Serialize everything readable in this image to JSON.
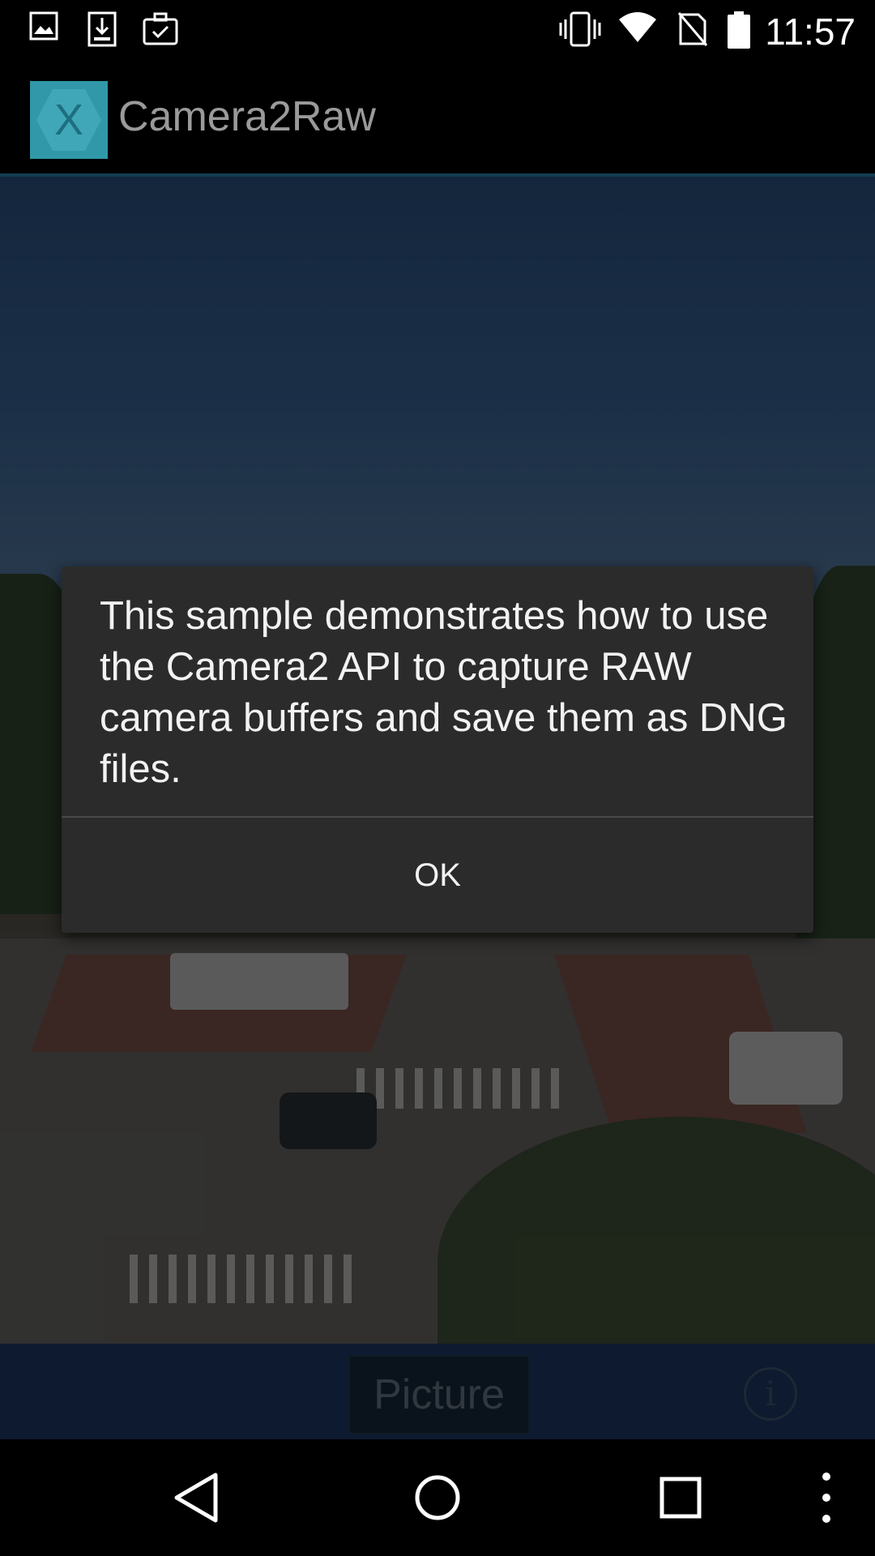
{
  "status_bar": {
    "time": "11:57",
    "left_icons": [
      "image-notification-icon",
      "download-notification-icon",
      "briefcase-notification-icon"
    ],
    "right_icons": [
      "vibrate-icon",
      "wifi-icon",
      "no-sim-icon",
      "battery-icon"
    ]
  },
  "action_bar": {
    "app_icon_letter": "X",
    "title": "Camera2Raw",
    "accent_color": "#3098a8"
  },
  "dialog": {
    "message": "This sample demonstrates how to use the Camera2 API to capture RAW camera buffers and save them as DNG files.",
    "ok_label": "OK"
  },
  "bottom_bar": {
    "picture_label": "Picture",
    "info_label": "i",
    "background_color": "#14284a"
  },
  "nav_bar": {
    "buttons": [
      "back-icon",
      "home-icon",
      "recents-icon",
      "overflow-menu-icon"
    ]
  }
}
